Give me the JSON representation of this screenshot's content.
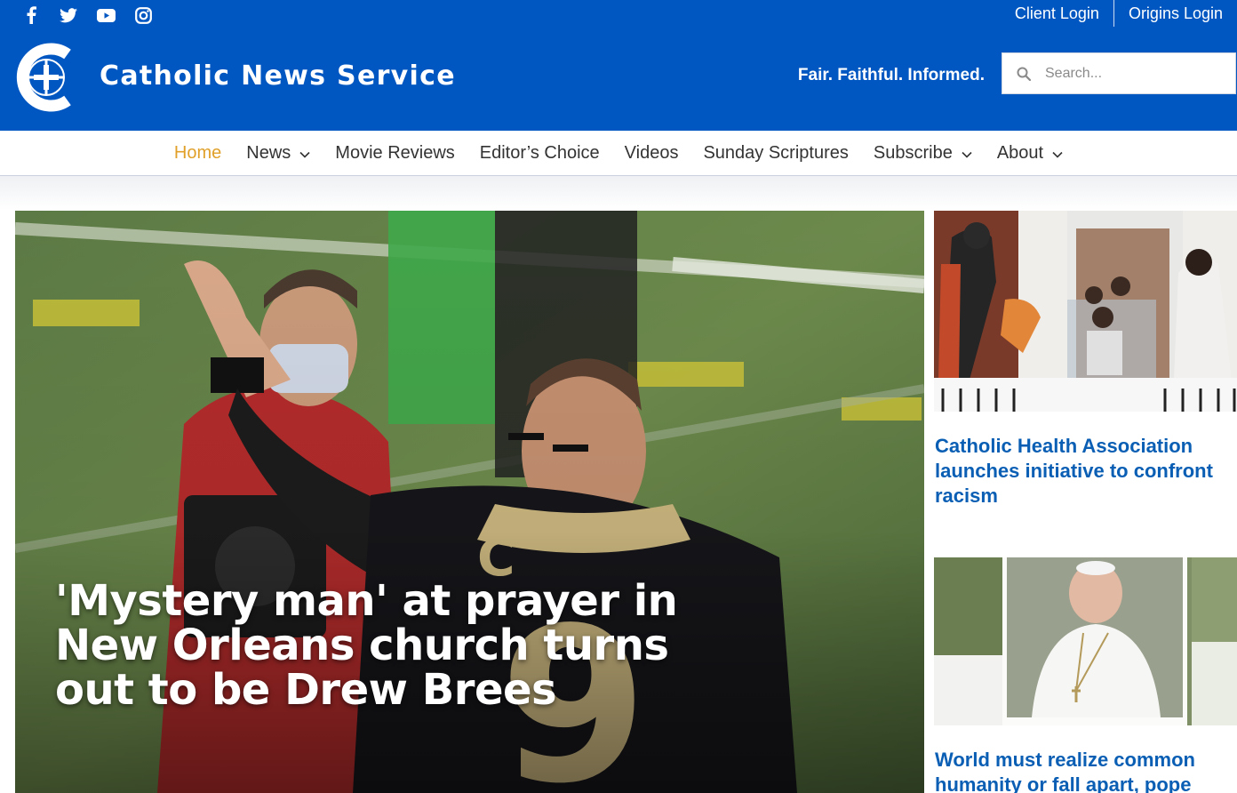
{
  "social": {
    "icons": [
      "facebook-icon",
      "twitter-icon",
      "youtube-icon",
      "instagram-icon"
    ]
  },
  "logins": {
    "client": "Client Login",
    "origins": "Origins Login"
  },
  "brand": {
    "name": "Catholic News Service",
    "tagline": "Fair. Faithful. Informed."
  },
  "search": {
    "placeholder": "Search..."
  },
  "nav": {
    "items": [
      {
        "label": "Home",
        "active": true
      },
      {
        "label": "News",
        "dropdown": true
      },
      {
        "label": "Movie Reviews"
      },
      {
        "label": "Editor’s Choice"
      },
      {
        "label": "Videos"
      },
      {
        "label": "Sunday Scriptures"
      },
      {
        "label": "Subscribe",
        "dropdown": true
      },
      {
        "label": "About",
        "dropdown": true
      }
    ]
  },
  "hero": {
    "title": "'Mystery man' at prayer in New Orleans church turns out to be Drew Brees"
  },
  "side": {
    "card1": {
      "headline": "Catholic Health Association launches initiative to confront racism"
    },
    "card2": {
      "headline": "World must realize common humanity or fall apart, pope"
    }
  },
  "colors": {
    "header_blue": "#0057c2",
    "nav_active": "#e0a029",
    "headline_blue": "#0a5fb4"
  }
}
